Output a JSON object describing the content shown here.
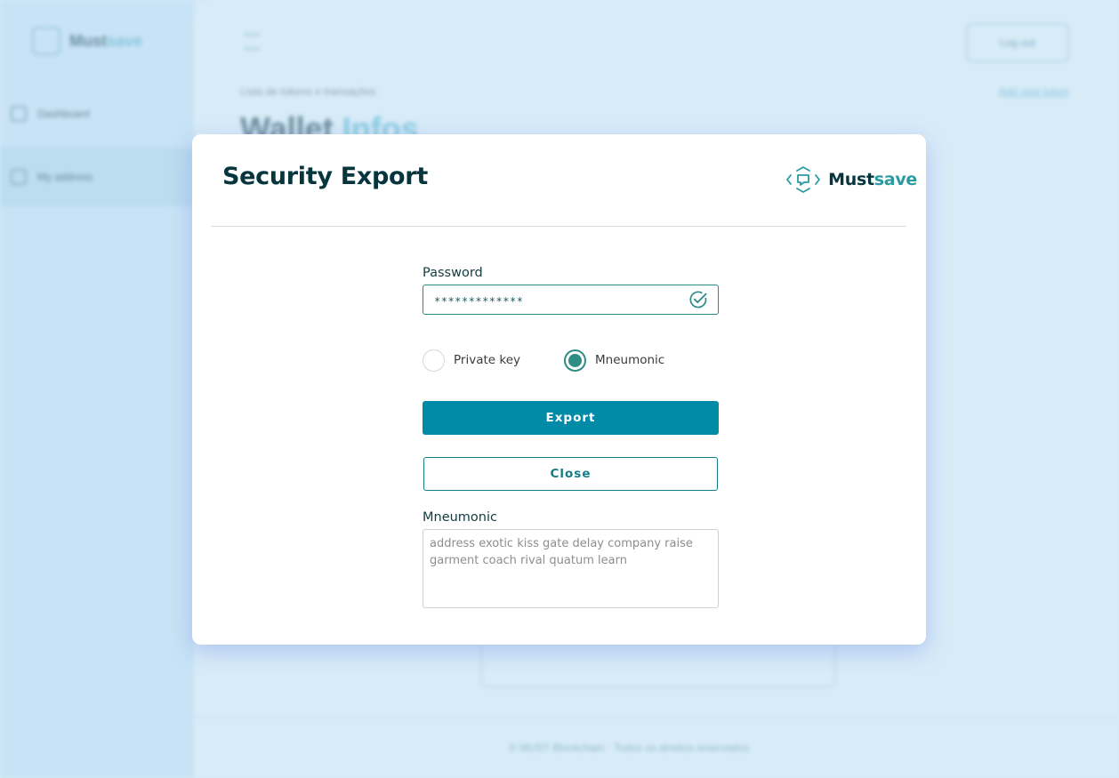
{
  "background": {
    "brand": {
      "part1": "Must",
      "part2": "save"
    },
    "nav": [
      {
        "label": "Dashboard",
        "icon": "grid-icon"
      },
      {
        "label": "My address",
        "icon": "pencil-icon"
      }
    ],
    "logout_label": "Log out",
    "subtitle": "Lista de tokens e transações",
    "link_label": "Add new token",
    "page_title": {
      "part1": "Wallet",
      "part2": "Infos"
    },
    "footer_text": "© MUST Blockchain · Todos os direitos reservados"
  },
  "modal": {
    "title": "Security Export",
    "brand": {
      "part1": "Must",
      "part2": "save",
      "icon": "mustsave-logo-icon"
    },
    "password": {
      "label": "Password",
      "value": "*************",
      "status_icon": "check-circle-icon"
    },
    "radios": [
      {
        "label": "Private key",
        "checked": false
      },
      {
        "label": "Mneumonic",
        "checked": true
      }
    ],
    "export_label": "Export",
    "close_label": "Close",
    "mnemonic": {
      "label": "Mneumonic",
      "text": "address exotic kiss gate delay company raise garment coach rival quatum learn"
    }
  },
  "colors": {
    "primary": "#028ba6",
    "accent": "#2b9ba2",
    "heading": "#06353d",
    "radio_checked": "#2e8e84",
    "backdrop": "#d4eaf7"
  }
}
